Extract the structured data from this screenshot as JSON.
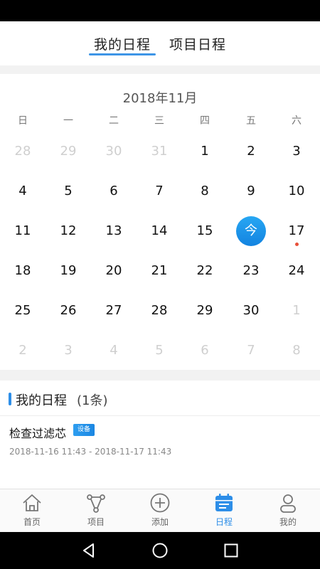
{
  "tabs": {
    "mine": "我的日程",
    "project": "项目日程"
  },
  "calendar": {
    "title": "2018年11月",
    "weekdays": [
      "日",
      "一",
      "二",
      "三",
      "四",
      "五",
      "六"
    ],
    "rows": [
      [
        {
          "d": "28",
          "m": true
        },
        {
          "d": "29",
          "m": true
        },
        {
          "d": "30",
          "m": true
        },
        {
          "d": "31",
          "m": true
        },
        {
          "d": "1"
        },
        {
          "d": "2"
        },
        {
          "d": "3"
        }
      ],
      [
        {
          "d": "4"
        },
        {
          "d": "5"
        },
        {
          "d": "6"
        },
        {
          "d": "7"
        },
        {
          "d": "8"
        },
        {
          "d": "9"
        },
        {
          "d": "10"
        }
      ],
      [
        {
          "d": "11"
        },
        {
          "d": "12"
        },
        {
          "d": "13"
        },
        {
          "d": "14"
        },
        {
          "d": "15"
        },
        {
          "d": "今",
          "today": true
        },
        {
          "d": "17",
          "dot": true
        }
      ],
      [
        {
          "d": "18"
        },
        {
          "d": "19"
        },
        {
          "d": "20"
        },
        {
          "d": "21"
        },
        {
          "d": "22"
        },
        {
          "d": "23"
        },
        {
          "d": "24"
        }
      ],
      [
        {
          "d": "25"
        },
        {
          "d": "26"
        },
        {
          "d": "27"
        },
        {
          "d": "28"
        },
        {
          "d": "29"
        },
        {
          "d": "30"
        },
        {
          "d": "1",
          "m": true
        }
      ],
      [
        {
          "d": "2",
          "m": true
        },
        {
          "d": "3",
          "m": true
        },
        {
          "d": "4",
          "m": true
        },
        {
          "d": "5",
          "m": true
        },
        {
          "d": "6",
          "m": true
        },
        {
          "d": "7",
          "m": true
        },
        {
          "d": "8",
          "m": true
        }
      ]
    ]
  },
  "schedule": {
    "title": "我的日程",
    "count": "(1条)",
    "item": {
      "title": "检查过滤芯",
      "badge": "设备",
      "time": "2018-11-16 11:43 - 2018-11-17 11:43"
    }
  },
  "nav": {
    "items": [
      {
        "label": "首页",
        "icon": "home-icon"
      },
      {
        "label": "项目",
        "icon": "project-icon"
      },
      {
        "label": "添加",
        "icon": "add-icon"
      },
      {
        "label": "日程",
        "icon": "calendar-icon",
        "active": true
      },
      {
        "label": "我的",
        "icon": "user-icon"
      }
    ]
  },
  "colors": {
    "accent": "#2d8ee8",
    "today": "#1a8be6",
    "dot": "#e8503a"
  }
}
